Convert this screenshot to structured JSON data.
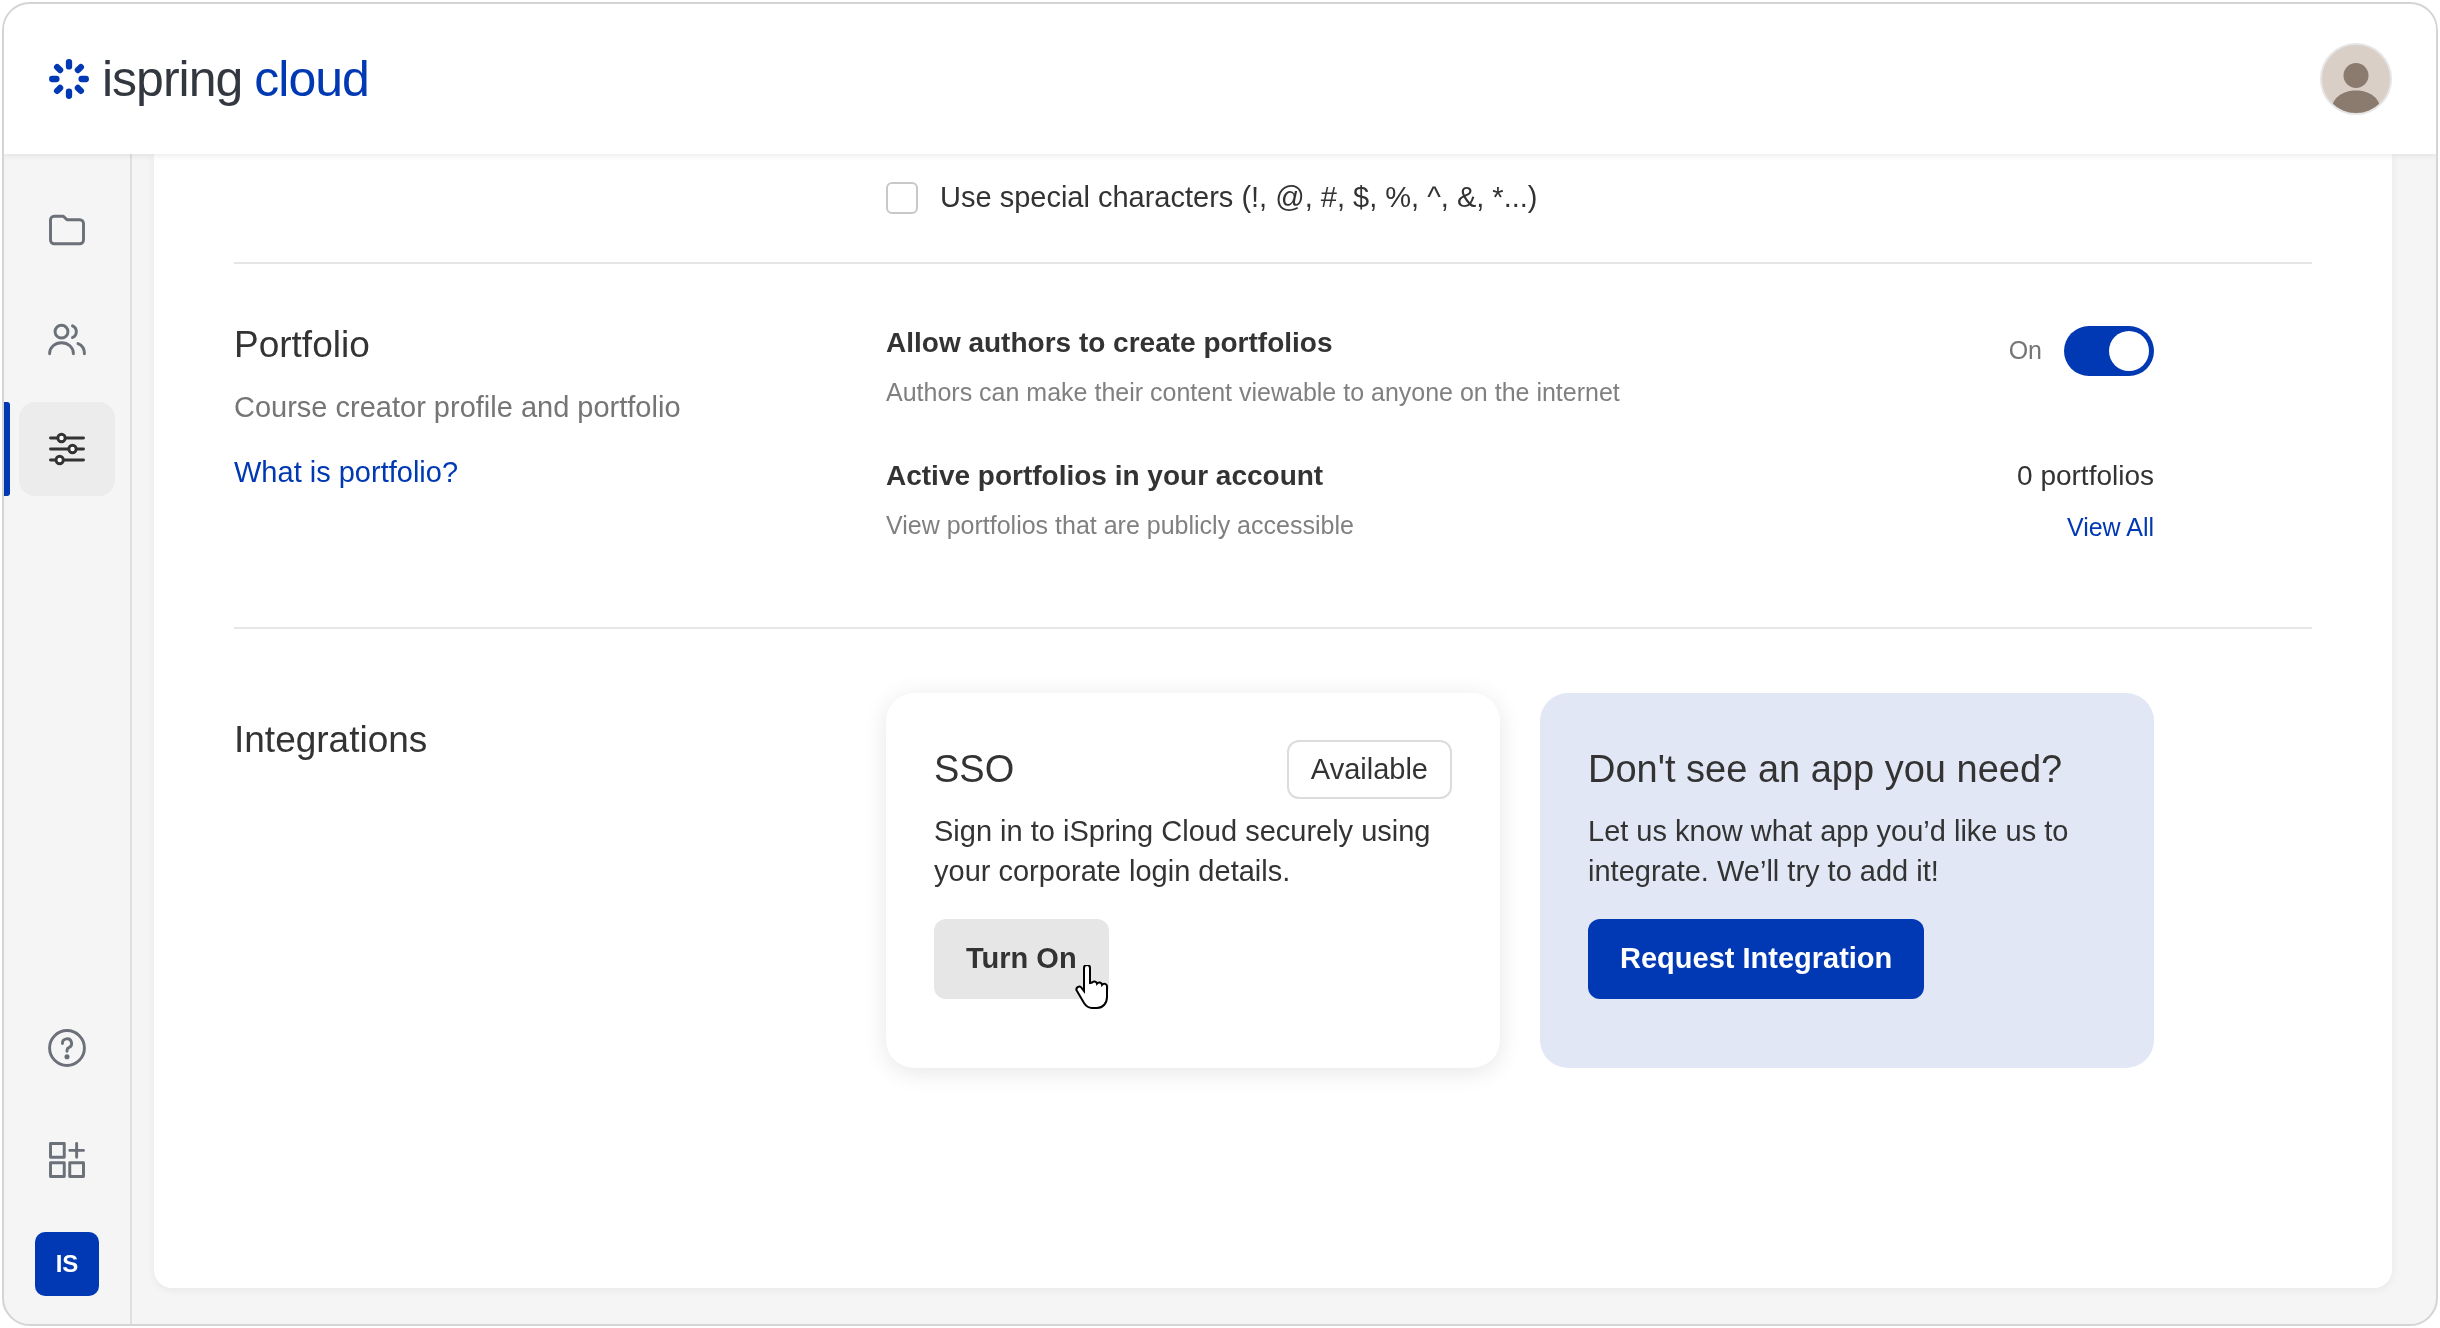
{
  "header": {
    "logo": {
      "word_1": "ispring",
      "word_2": "cloud"
    }
  },
  "sidebar": {
    "items": [
      {
        "kind": "folder",
        "selected": false
      },
      {
        "kind": "users",
        "selected": false
      },
      {
        "kind": "settings",
        "selected": true
      }
    ],
    "bottom": [
      {
        "kind": "help"
      },
      {
        "kind": "apps"
      }
    ],
    "account_badge": "IS"
  },
  "password_options": [
    {
      "label": "Use special characters (!, @, #, $, %, ^, &, *...)",
      "checked": false
    }
  ],
  "portfolio": {
    "title": "Portfolio",
    "subtitle": "Course creator profile and portfolio",
    "link": "What is portfolio?",
    "settings": [
      {
        "kind": "toggle",
        "title": "Allow authors to create portfolios",
        "description": "Authors can make their content viewable to anyone on the internet",
        "state_label": "On",
        "on": true
      },
      {
        "kind": "count",
        "title": "Active portfolios in your account",
        "description": "View portfolios that are publicly accessible",
        "count": "0 portfolios",
        "link": "View All"
      }
    ]
  },
  "integrations": {
    "title": "Integrations",
    "cards": [
      {
        "kind": "app",
        "title": "SSO",
        "badge": "Available",
        "text": "Sign in to iSpring Cloud securely using your corporate login details.",
        "button": "Turn On"
      },
      {
        "kind": "request",
        "title": "Don't see an app you need?",
        "text": "Let us know what app you’d like us to integrate. We’ll try to add it!",
        "button": "Request Integration"
      }
    ]
  }
}
